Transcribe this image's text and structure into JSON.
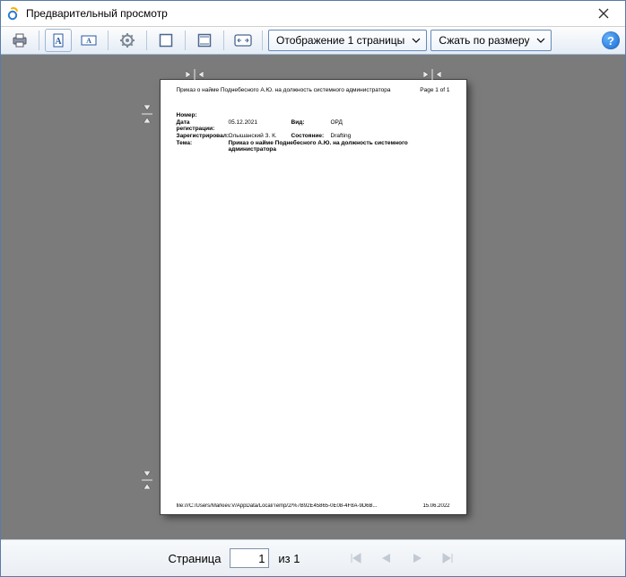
{
  "window": {
    "title": "Предварительный просмотр"
  },
  "toolbar": {
    "view_combo": "Отображение 1 страницы",
    "zoom_combo": "Сжать по размеру"
  },
  "preview": {
    "header_title": "Приказ о найме Поднебесного А.Ю. на должность системного администратора",
    "header_page": "Page 1 of 1",
    "fields": {
      "number_label": "Номер:",
      "number_value": "",
      "regdate_label": "Дата регистрации:",
      "regdate_value": "05.12.2021",
      "kind_label": "Вид:",
      "kind_value": "ОРД",
      "registeredby_label": "Зарегистрировал:",
      "registeredby_value": "Олышанский З. К.",
      "state_label": "Состояние:",
      "state_value": "Drafting",
      "subject_label": "Тема:",
      "subject_value": "Приказ о найме Поднебесного А.Ю. на должность системного администратора"
    },
    "footer_path": "file:///C:/Users/Markiev.V/AppData/Local/Temp/2/%7B92E45865-0E08-4F8A-9D6B...",
    "footer_date": "15.06.2022"
  },
  "pager": {
    "label_prefix": "Страница",
    "current": "1",
    "label_suffix": "из 1"
  }
}
